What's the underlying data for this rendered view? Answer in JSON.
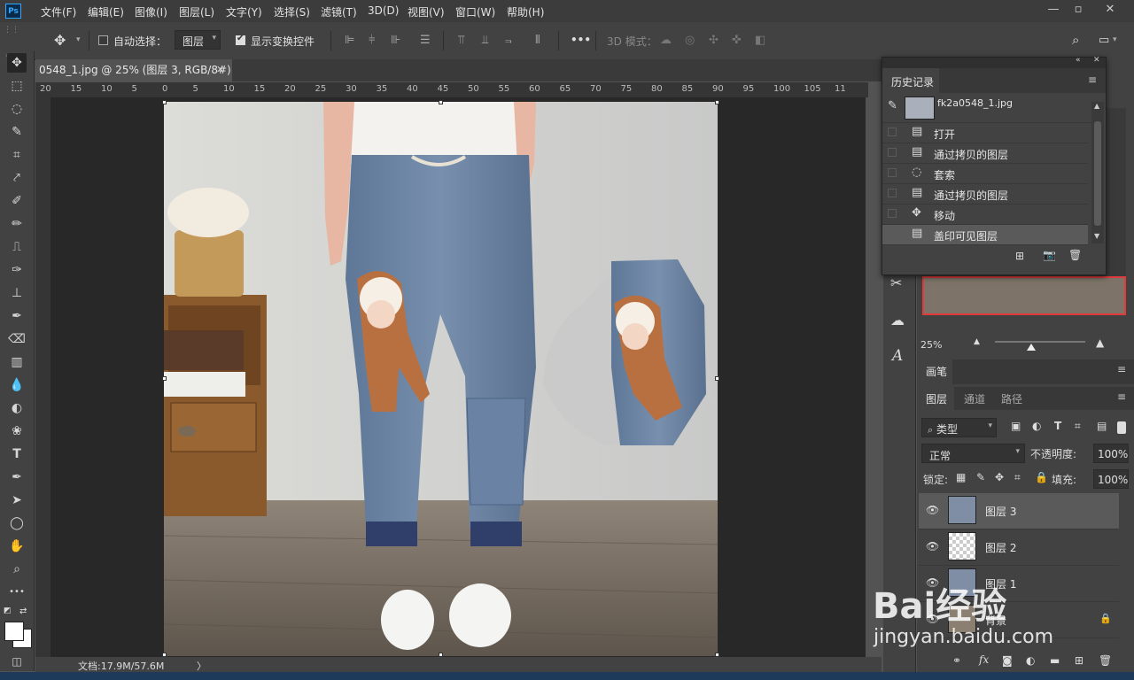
{
  "app": {
    "logo": "Ps"
  },
  "menu": [
    "文件(F)",
    "编辑(E)",
    "图像(I)",
    "图层(L)",
    "文字(Y)",
    "选择(S)",
    "滤镜(T)",
    "3D(D)",
    "视图(V)",
    "窗口(W)",
    "帮助(H)"
  ],
  "window_controls": {
    "minimize": "—",
    "restore": "▫",
    "close": "✕"
  },
  "options": {
    "auto_select_label": "自动选择：",
    "auto_select_value": "图层",
    "show_transform_label": "显示变换控件",
    "more": "•••",
    "mode_3d": "3D 模式："
  },
  "document": {
    "tab_title": "0548_1.jpg @ 25% (图层 3, RGB/8#) *",
    "tab_close": "✕",
    "status": "文档:17.9M/57.6M",
    "status_arrow": "〉"
  },
  "ruler": {
    "top": [
      "20",
      "15",
      "10",
      "5",
      "0",
      "5",
      "10",
      "15",
      "20",
      "25",
      "30",
      "35",
      "40",
      "45",
      "50",
      "55",
      "60",
      "65",
      "70",
      "75",
      "80",
      "85",
      "90",
      "95",
      "100",
      "105",
      "11"
    ]
  },
  "history": {
    "title": "历史记录",
    "snapshot": "fk2a0548_1.jpg",
    "items": [
      {
        "label": "打开",
        "icon": "document-icon"
      },
      {
        "label": "通过拷贝的图层",
        "icon": "document-icon"
      },
      {
        "label": "套索",
        "icon": "lasso-icon"
      },
      {
        "label": "通过拷贝的图层",
        "icon": "document-icon"
      },
      {
        "label": "移动",
        "icon": "move-icon"
      },
      {
        "label": "盖印可见图层",
        "icon": "document-icon"
      }
    ],
    "selected_index": 5
  },
  "navigator": {
    "zoom": "25%"
  },
  "brush_panel": {
    "title": "画笔"
  },
  "layers_panel": {
    "tabs": [
      "图层",
      "通道",
      "路径"
    ],
    "filter_label": "类型",
    "blend_mode": "正常",
    "opacity_label": "不透明度:",
    "opacity_value": "100%",
    "lock_label": "锁定:",
    "fill_label": "填充:",
    "fill_value": "100%",
    "layers": [
      {
        "name": "图层 3",
        "selected": true,
        "thumb": "photo"
      },
      {
        "name": "图层 2",
        "selected": false,
        "thumb": "transparent"
      },
      {
        "name": "图层 1",
        "selected": false,
        "thumb": "photo"
      },
      {
        "name": "背景",
        "selected": false,
        "thumb": "photo",
        "locked": true
      }
    ]
  },
  "watermark": {
    "brand": "Bai经验",
    "url": "jingyan.baidu.com"
  }
}
